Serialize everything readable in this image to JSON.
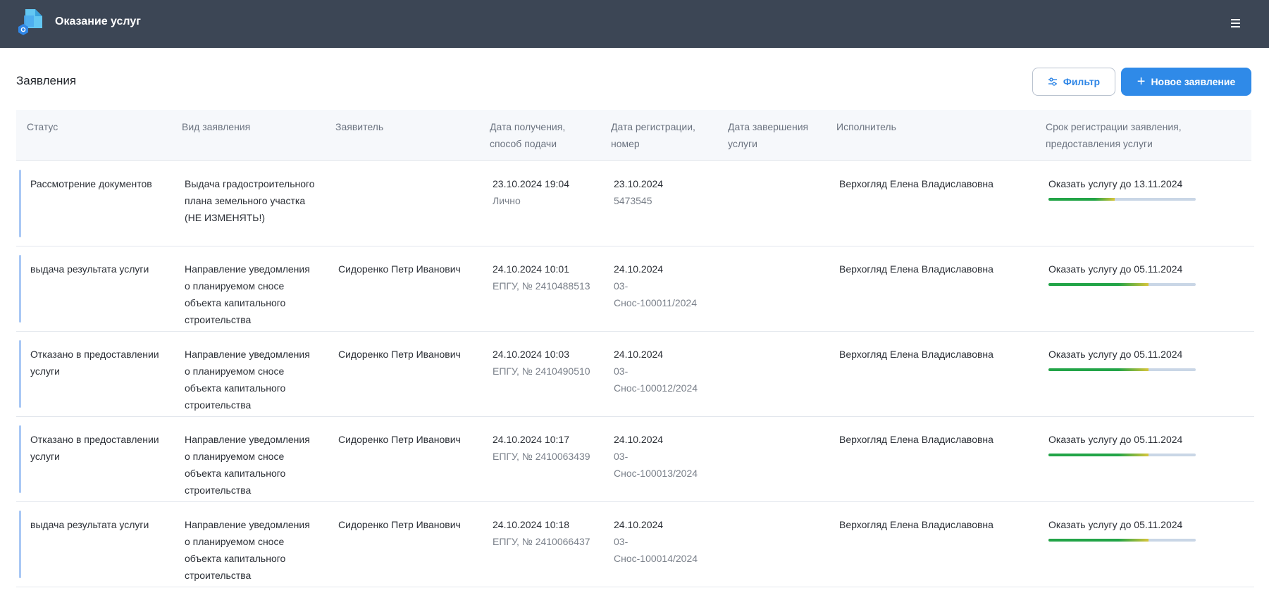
{
  "header": {
    "app_title": "Оказание услуг"
  },
  "page": {
    "title": "Заявления",
    "filter_label": "Фильтр",
    "new_label": "Новое заявление"
  },
  "table": {
    "columns": [
      "Статус",
      "Вид заявления",
      "Заявитель",
      "Дата получения, способ подачи",
      "Дата регистрации, номер",
      "Дата завершения услуги",
      "Исполнитель",
      "Срок регистрации заявления, предоставления услуги"
    ],
    "rows": [
      {
        "status": "Рассмотрение документов",
        "type": "Выдача градостроительного плана земельного участка (НЕ ИЗМЕНЯТЬ!)",
        "applicant": "",
        "received_date": "23.10.2024 19:04",
        "received_method": "Лично",
        "reg_date": "23.10.2024",
        "reg_number": "5473545",
        "completion": "",
        "executor": "Верхогляд Елена Владиславовна",
        "deadline": "Оказать услугу до 13.11.2024",
        "progress": 0.45
      },
      {
        "status": "выдача результата услуги",
        "type": "Направление уведомления о планируемом сносе объекта капитального строительства",
        "applicant": "Сидоренко Петр Иванович",
        "received_date": "24.10.2024 10:01",
        "received_method": "ЕПГУ, № 2410488513",
        "reg_date": "24.10.2024",
        "reg_number": "03-Снос-100011/2024",
        "completion": "",
        "executor": "Верхогляд Елена Владиславовна",
        "deadline": "Оказать услугу до 05.11.2024",
        "progress": 0.68
      },
      {
        "status": "Отказано в предоставлении услуги",
        "type": "Направление уведомления о планируемом сносе объекта капитального строительства",
        "applicant": "Сидоренко Петр Иванович",
        "received_date": "24.10.2024 10:03",
        "received_method": "ЕПГУ, № 2410490510",
        "reg_date": "24.10.2024",
        "reg_number": "03-Снос-100012/2024",
        "completion": "",
        "executor": "Верхогляд Елена Владиславовна",
        "deadline": "Оказать услугу до 05.11.2024",
        "progress": 0.68
      },
      {
        "status": "Отказано в предоставлении услуги",
        "type": "Направление уведомления о планируемом сносе объекта капитального строительства",
        "applicant": "Сидоренко Петр Иванович",
        "received_date": "24.10.2024 10:17",
        "received_method": "ЕПГУ, № 2410063439",
        "reg_date": "24.10.2024",
        "reg_number": "03-Снос-100013/2024",
        "completion": "",
        "executor": "Верхогляд Елена Владиславовна",
        "deadline": "Оказать услугу до 05.11.2024",
        "progress": 0.68
      },
      {
        "status": "выдача результата услуги",
        "type": "Направление уведомления о планируемом сносе объекта капитального строительства",
        "applicant": "Сидоренко Петр Иванович",
        "received_date": "24.10.2024 10:18",
        "received_method": "ЕПГУ, № 2410066437",
        "reg_date": "24.10.2024",
        "reg_number": "03-Снос-100014/2024",
        "completion": "",
        "executor": "Верхогляд Елена Владиславовна",
        "deadline": "Оказать услугу до 05.11.2024",
        "progress": 0.68
      }
    ]
  },
  "colors": {
    "topbar": "#3c4655",
    "accent": "#2f8ae8",
    "row_marker": "#a9c8f5",
    "progress_green": "#22a447",
    "progress_yellow": "#d8c53a",
    "progress_track": "#c9d6e6"
  },
  "icons": {
    "logo": "documents-cube-logo",
    "menu": "hamburger-menu-icon",
    "filter": "sliders-filter-icon",
    "plus": "plus-icon"
  }
}
